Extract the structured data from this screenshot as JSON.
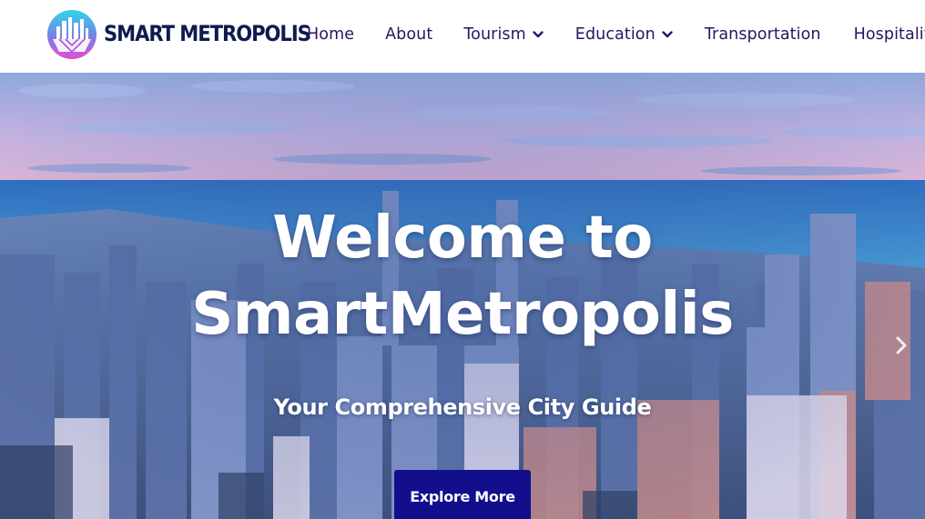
{
  "brand": {
    "name": "SMART METROPOLIS",
    "logo_icon": "city-skyline-logo-icon",
    "colors": {
      "navy": "#0d1b4f",
      "cyan": "#2fd6e8",
      "magenta": "#e14fd2"
    }
  },
  "nav": {
    "items": [
      {
        "label": "Home",
        "dropdown": false
      },
      {
        "label": "About",
        "dropdown": false
      },
      {
        "label": "Tourism",
        "dropdown": true
      },
      {
        "label": "Education",
        "dropdown": true
      },
      {
        "label": "Transportation",
        "dropdown": false
      },
      {
        "label": "Hospitalit",
        "dropdown": false
      }
    ],
    "text_color": "#2b1363",
    "dropdown_icon": "chevron-down-icon"
  },
  "hero": {
    "title_line1": "Welcome to",
    "title_line2": "SmartMetropolis",
    "subtitle": "Your Comprehensive City Guide",
    "cta_label": "Explore More",
    "cta_color": "#130f8c",
    "next_icon": "chevron-right-icon",
    "background": "aerial-city-skyline-photo"
  }
}
